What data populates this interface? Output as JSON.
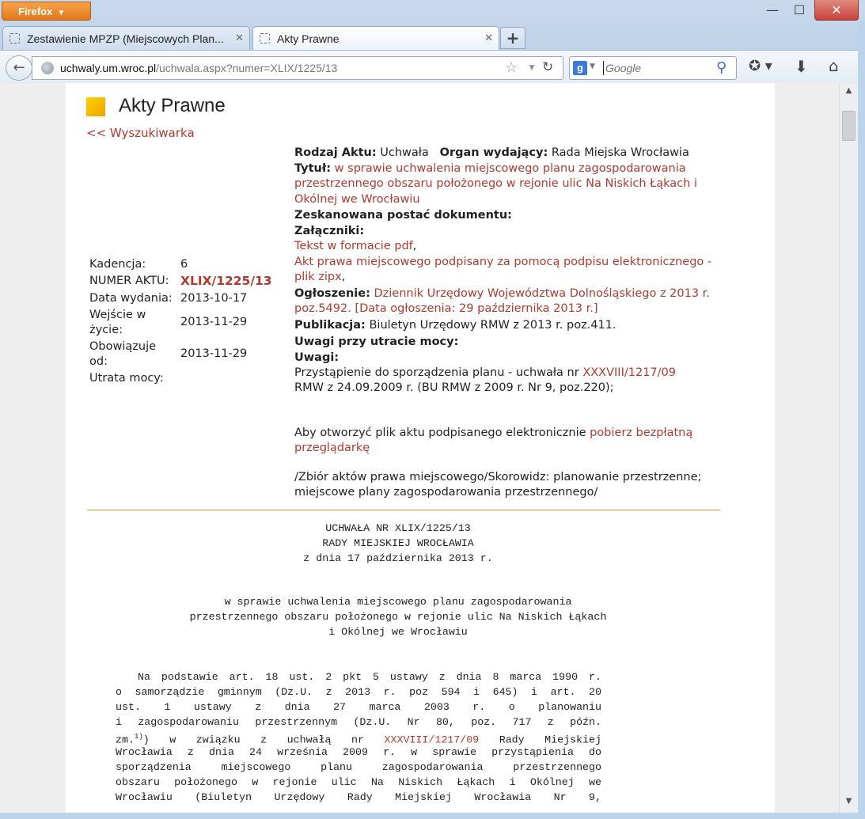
{
  "browser": {
    "app_button": "Firefox",
    "tabs": [
      {
        "title": "Zestawienie MPZP (Miejscowych Plan..."
      },
      {
        "title": "Akty Prawne"
      }
    ],
    "url_host": "uchwaly.um.wroc.pl",
    "url_path": "/uchwala.aspx?numer=XLIX/1225/13",
    "search_placeholder": "Google"
  },
  "page": {
    "title": "Akty Prawne",
    "back_link": "<< Wyszukiwarka",
    "meta": {
      "kadencja_label": "Kadencja:",
      "kadencja": "6",
      "numer_label": "NUMER AKTU:",
      "numer": "XLIX/1225/13",
      "data_label": "Data wydania:",
      "data": "2013-10-17",
      "wejscie_label_1": "Wejście w",
      "wejscie_label_2": "życie:",
      "wejscie": "2013-11-29",
      "obowiazuje_label_1": "Obowiązuje",
      "obowiazuje_label_2": "od:",
      "obowiazuje": "2013-11-29",
      "utrata_label": "Utrata mocy:"
    },
    "info": {
      "rodzaj_label": "Rodzaj Aktu:",
      "rodzaj": "Uchwała",
      "organ_label": "Organ wydający:",
      "organ": "Rada Miejska Wrocławia",
      "tytul_label": "Tytuł:",
      "tytul": "w sprawie uchwalenia miejscowego planu zagospodarowania przestrzennego obszaru położonego w rejonie ulic Na Niskich Łąkach i Okólnej we Wrocławiu",
      "skan_label": "Zeskanowana postać dokumentu:",
      "zalaczniki_label": "Załączniki:",
      "zal_1": "Tekst w formacie pdf",
      "zal_2": "Akt prawa miejscowego podpisany za pomocą podpisu elektronicznego - plik zipx",
      "ogloszenie_label": "Ogłoszenie:",
      "ogloszenie": "Dziennik Urzędowy Województwa Dolnośląskiego z 2013 r. poz.5492. [Data ogłoszenia: 29 października 2013 r.]",
      "publikacja_label": "Publikacja:",
      "publikacja": "Biuletyn Urzędowy RMW z 2013 r. poz.411.",
      "uwagi_utrata_label": "Uwagi przy utracie mocy:",
      "uwagi_label": "Uwagi:",
      "uwagi_pre": "Przystąpienie do sporządzenia planu - uchwała nr ",
      "uwagi_link": "XXXVIII/1217/09",
      "uwagi_post": "RMW z 24.09.2009 r. (BU RMW z 2009 r. Nr 9, poz.220);",
      "viewer_pre": "Aby otworzyć plik aktu podpisanego elektronicznie ",
      "viewer_link": "pobierz bezpłatną przeglądarkę",
      "skorowidz": "/Zbiór aktów prawa miejscowego/Skorowidz: planowanie przestrzenne; miejscowe plany zagospodarowania przestrzennego/"
    },
    "document": {
      "head_1": "UCHWAŁA NR XLIX/1225/13",
      "head_2": "RADY MIEJSKIEJ WROCŁAWIA",
      "head_3": "z dnia 17 października 2013 r.",
      "subj_1": "w sprawie uchwalenia miejscowego planu zagospodarowania",
      "subj_2": "przestrzennego obszaru położonego w rejonie ulic Na Niskich Łąkach",
      "subj_3": "i Okólnej we Wrocławiu",
      "p1": "Na podstawie art. 18 ust. 2 pkt 5 ustawy z dnia 8 marca 1990 r.",
      "p2": "o samorządzie gminnym (Dz.U. z 2013 r. poz 594 i 645) i art. 20",
      "p3": "ust. 1 ustawy z dnia 27 marca 2003 r. o planowaniu",
      "p4": "i zagospodarowaniu przestrzennym (Dz.U. Nr 80, poz. 717 z późn.",
      "p5_pre": "zm.",
      "p5_sup": "1)",
      "p5_mid": ") w związku z uchwałą nr ",
      "p5_link": "XXXVIII/1217/09",
      "p5_post": " Rady Miejskiej",
      "p6": "Wrocławia z dnia 24 września 2009 r. w sprawie przystąpienia do",
      "p7": "sporządzenia miejscowego planu zagospodarowania przestrzennego",
      "p8": "obszaru położonego w rejonie ulic Na Niskich Łąkach i Okólnej we",
      "p9": "Wrocławiu (Biuletyn Urzędowy Rady Miejskiej Wrocławia Nr 9,"
    }
  }
}
